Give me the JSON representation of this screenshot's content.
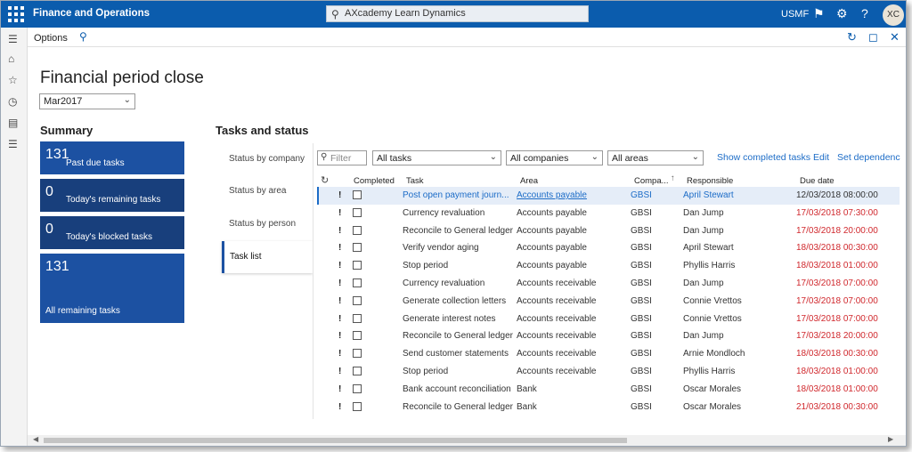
{
  "navbar": {
    "app_title": "Finance and Operations",
    "search_placeholder": "AXcademy Learn Dynamics",
    "company": "USMF",
    "avatar_initials": "XC",
    "icons": [
      "waffle-icon",
      "search-icon",
      "notification-icon",
      "gear-icon",
      "help-icon"
    ]
  },
  "actionbar": {
    "options_label": "Options"
  },
  "page": {
    "title": "Financial period close",
    "period": "Mar2017"
  },
  "summary": {
    "heading": "Summary",
    "tiles": [
      {
        "count": "131",
        "label": "Past due tasks"
      },
      {
        "count": "0",
        "label": "Today's remaining tasks"
      },
      {
        "count": "0",
        "label": "Today's blocked tasks"
      },
      {
        "count": "131",
        "label": "All remaining tasks"
      }
    ]
  },
  "tasks": {
    "heading": "Tasks and status",
    "tabs": [
      "Status by company",
      "Status by area",
      "Status by person",
      "Task list"
    ],
    "active_tab": "Task list",
    "filter": {
      "search_placeholder": "Filter",
      "tasks_select": "All tasks",
      "companies_select": "All companies",
      "areas_select": "All areas",
      "show_completed": "Show completed tasks",
      "edit": "Edit",
      "set_dependencies": "Set dependenc"
    },
    "columns": [
      "Completed",
      "Task",
      "Area",
      "Compa...",
      "Responsible",
      "Due date"
    ],
    "rows": [
      {
        "task": "Post open payment journ...",
        "area": "Accounts payable",
        "company": "GBSI",
        "responsible": "April Stewart",
        "due": "12/03/2018 08:00:00",
        "overdue": false
      },
      {
        "task": "Currency revaluation",
        "area": "Accounts payable",
        "company": "GBSI",
        "responsible": "Dan Jump",
        "due": "17/03/2018 07:30:00",
        "overdue": true
      },
      {
        "task": "Reconcile to General ledger",
        "area": "Accounts payable",
        "company": "GBSI",
        "responsible": "Dan Jump",
        "due": "17/03/2018 20:00:00",
        "overdue": true
      },
      {
        "task": "Verify vendor aging",
        "area": "Accounts payable",
        "company": "GBSI",
        "responsible": "April Stewart",
        "due": "18/03/2018 00:30:00",
        "overdue": true
      },
      {
        "task": "Stop period",
        "area": "Accounts payable",
        "company": "GBSI",
        "responsible": "Phyllis Harris",
        "due": "18/03/2018 01:00:00",
        "overdue": true
      },
      {
        "task": "Currency revaluation",
        "area": "Accounts receivable",
        "company": "GBSI",
        "responsible": "Dan Jump",
        "due": "17/03/2018 07:00:00",
        "overdue": true
      },
      {
        "task": "Generate collection letters",
        "area": "Accounts receivable",
        "company": "GBSI",
        "responsible": "Connie Vrettos",
        "due": "17/03/2018 07:00:00",
        "overdue": true
      },
      {
        "task": "Generate interest notes",
        "area": "Accounts receivable",
        "company": "GBSI",
        "responsible": "Connie Vrettos",
        "due": "17/03/2018 07:00:00",
        "overdue": true
      },
      {
        "task": "Reconcile to General ledger",
        "area": "Accounts receivable",
        "company": "GBSI",
        "responsible": "Dan Jump",
        "due": "17/03/2018 20:00:00",
        "overdue": true
      },
      {
        "task": "Send customer statements",
        "area": "Accounts receivable",
        "company": "GBSI",
        "responsible": "Arnie Mondloch",
        "due": "18/03/2018 00:30:00",
        "overdue": true
      },
      {
        "task": "Stop period",
        "area": "Accounts receivable",
        "company": "GBSI",
        "responsible": "Phyllis Harris",
        "due": "18/03/2018 01:00:00",
        "overdue": true
      },
      {
        "task": "Bank account reconciliation",
        "area": "Bank",
        "company": "GBSI",
        "responsible": "Oscar Morales",
        "due": "18/03/2018 01:00:00",
        "overdue": true
      },
      {
        "task": "Reconcile to General ledger",
        "area": "Bank",
        "company": "GBSI",
        "responsible": "Oscar Morales",
        "due": "21/03/2018 00:30:00",
        "overdue": true
      }
    ]
  },
  "colors": {
    "nav": "#0b5cad",
    "tile": "#1c51a2",
    "tile_dark": "#183f7c",
    "overdue": "#d0282d",
    "link": "#1c6cc7"
  }
}
